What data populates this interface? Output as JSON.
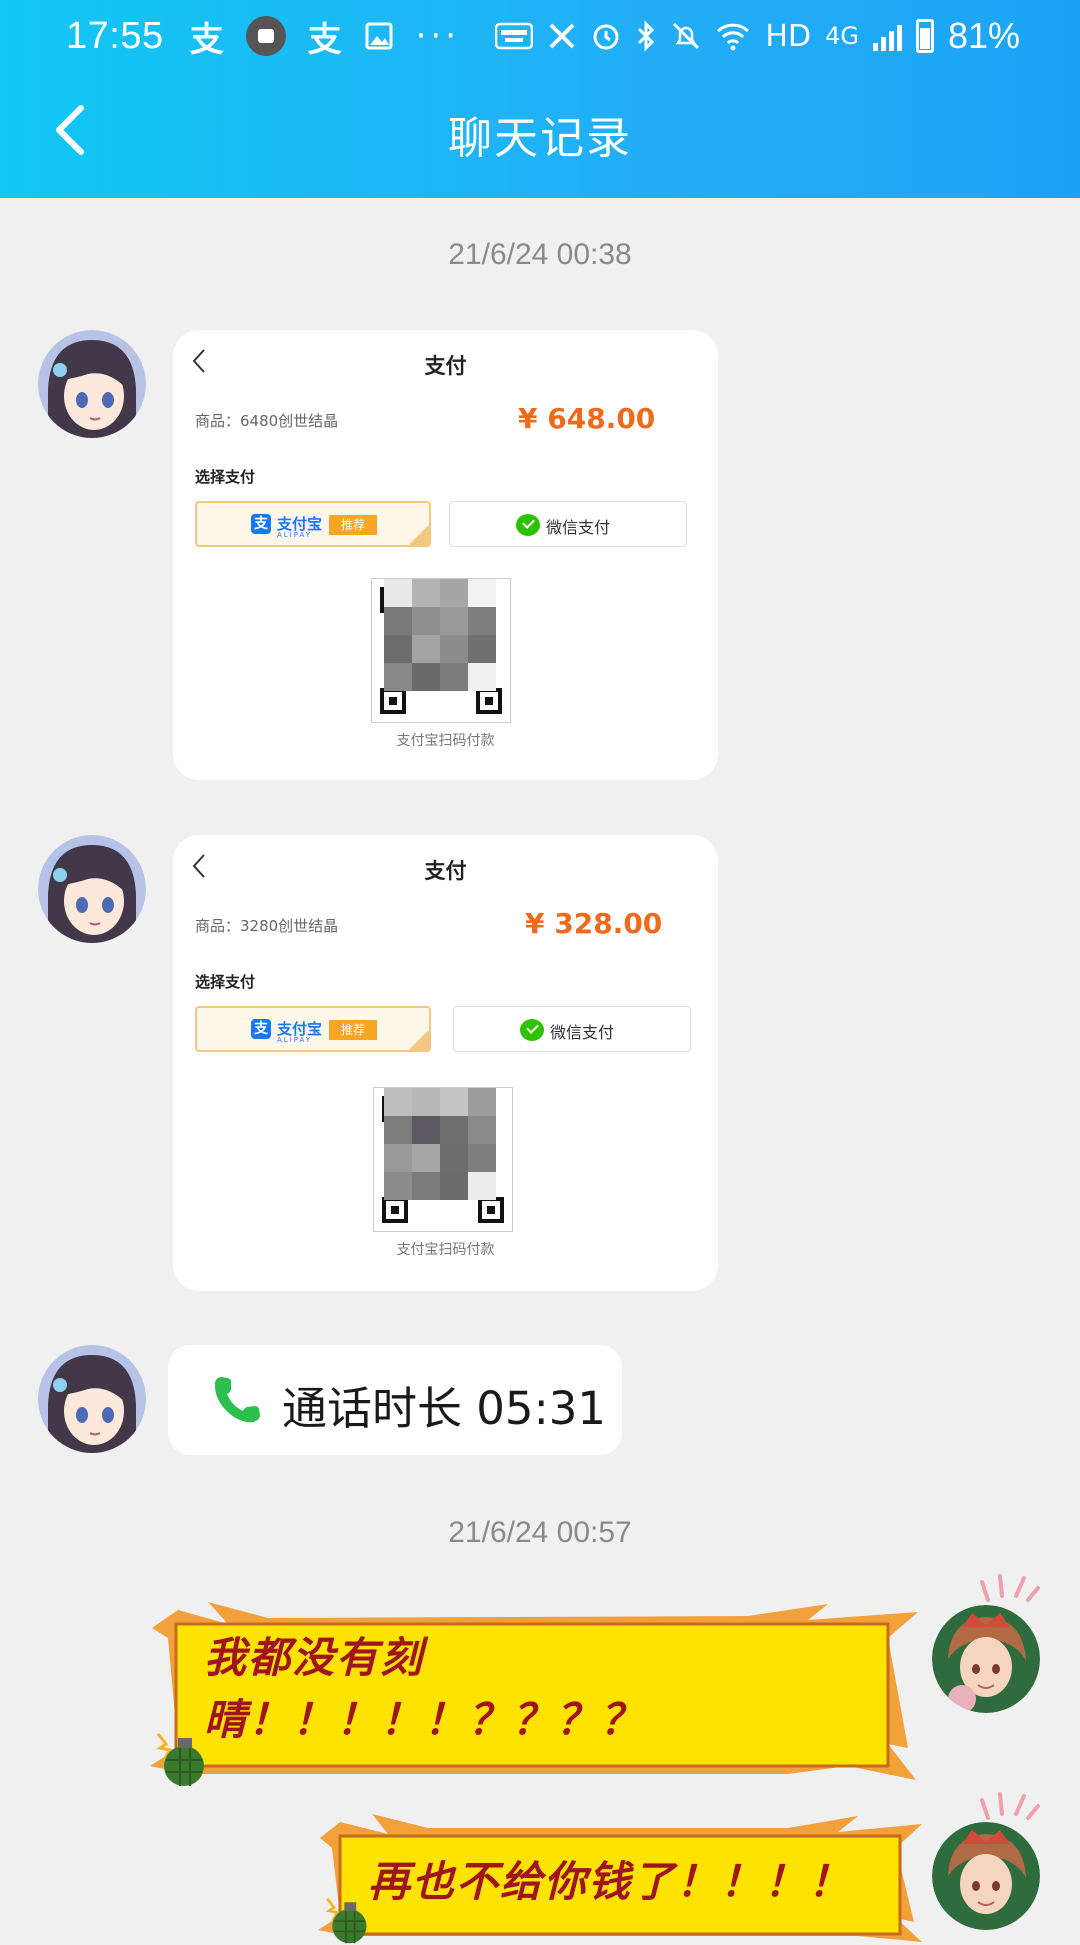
{
  "status_bar": {
    "time": "17:55",
    "left_icons": [
      "alipay-icon",
      "notification-badge-icon",
      "alipay-icon",
      "gallery-icon",
      "more-dots-icon"
    ],
    "right_icons": [
      "auto-hz-icon",
      "x-icon",
      "alarm-icon",
      "bluetooth-icon",
      "mute-icon",
      "wifi-icon",
      "hd-label",
      "4g-label",
      "signal-icon",
      "battery-icon"
    ],
    "hd_label": "HD",
    "network_label": "4G",
    "battery": "81%"
  },
  "header": {
    "title": "聊天记录",
    "back_icon": "chevron-left-icon",
    "gradient_start": "#12c7f4",
    "gradient_end": "#1ca3f7"
  },
  "messages": [
    {
      "type": "timestamp",
      "text": "21/6/24 00:38"
    },
    {
      "type": "payment_screenshot",
      "sender": "left",
      "title": "支付",
      "product": "商品：6480创世结晶",
      "price": "¥ 648.00",
      "choose_label": "选择支付",
      "alipay_name": "支付宝",
      "alipay_sub": "ALIPAY",
      "alipay_tag": "推荐",
      "wechat_label": "微信支付",
      "qr_caption": "支付宝扫码付款"
    },
    {
      "type": "payment_screenshot",
      "sender": "left",
      "title": "支付",
      "product": "商品：3280创世结晶",
      "price": "¥ 328.00",
      "choose_label": "选择支付",
      "alipay_name": "支付宝",
      "alipay_sub": "ALIPAY",
      "alipay_tag": "推荐",
      "wechat_label": "微信支付",
      "qr_caption": "支付宝扫码付款"
    },
    {
      "type": "call",
      "sender": "left",
      "icon": "phone-icon",
      "text": "通话时长 05:31"
    },
    {
      "type": "timestamp",
      "text": "21/6/24 00:57"
    },
    {
      "type": "sticker_bubble",
      "sender": "right",
      "lines": [
        "我都没有刻",
        "晴！！！！！？？？？"
      ]
    },
    {
      "type": "sticker_bubble",
      "sender": "right",
      "lines": [
        "再也不给你钱了！！！！"
      ]
    }
  ],
  "colors": {
    "chat_background": "#f0f0f0",
    "price_orange": "#ef6a1b",
    "sticker_yellow": "#ffe300",
    "sticker_text": "#a0141e",
    "call_green": "#2dbf4e"
  }
}
